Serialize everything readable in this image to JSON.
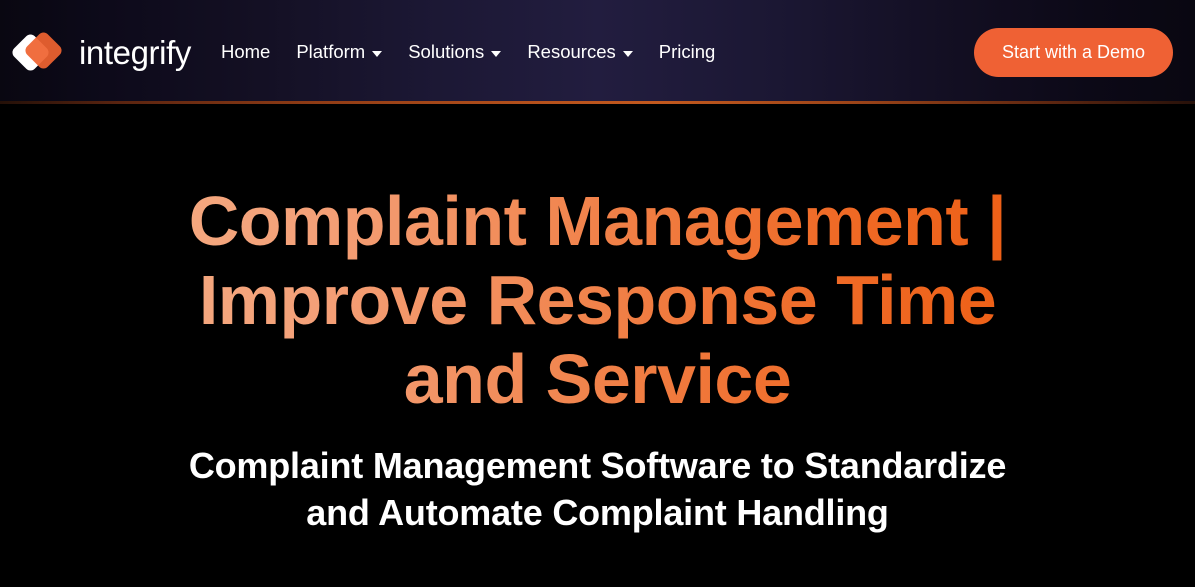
{
  "brand": {
    "name": "integrify",
    "logo_icon": "integrify-diamond-logo",
    "logo_colors": [
      "#ffffff",
      "#ef6330"
    ]
  },
  "header": {
    "background_gradient": [
      "#090711",
      "#221d3f",
      "#090711"
    ],
    "accent_rule_color": "#c2591e",
    "nav": [
      {
        "label": "Home",
        "has_dropdown": false
      },
      {
        "label": "Platform",
        "has_dropdown": true
      },
      {
        "label": "Solutions",
        "has_dropdown": true
      },
      {
        "label": "Resources",
        "has_dropdown": true
      },
      {
        "label": "Pricing",
        "has_dropdown": false
      }
    ],
    "cta": {
      "label": "Start with a Demo",
      "background_color": "#ef6134",
      "text_color": "#ffffff"
    }
  },
  "hero": {
    "background_color": "#000000",
    "title_lines": [
      "Complaint Management |",
      "Improve Response Time",
      "and Service"
    ],
    "title_text": "Complaint Management | Improve Response Time and Service",
    "title_gradient": [
      "#f4a87f",
      "#ee5f15"
    ],
    "subtitle_lines": [
      "Complaint Management Software to Standardize",
      "and Automate Complaint Handling"
    ],
    "subtitle_text": "Complaint Management Software to Standardize and Automate Complaint Handling",
    "subtitle_color": "#ffffff"
  }
}
